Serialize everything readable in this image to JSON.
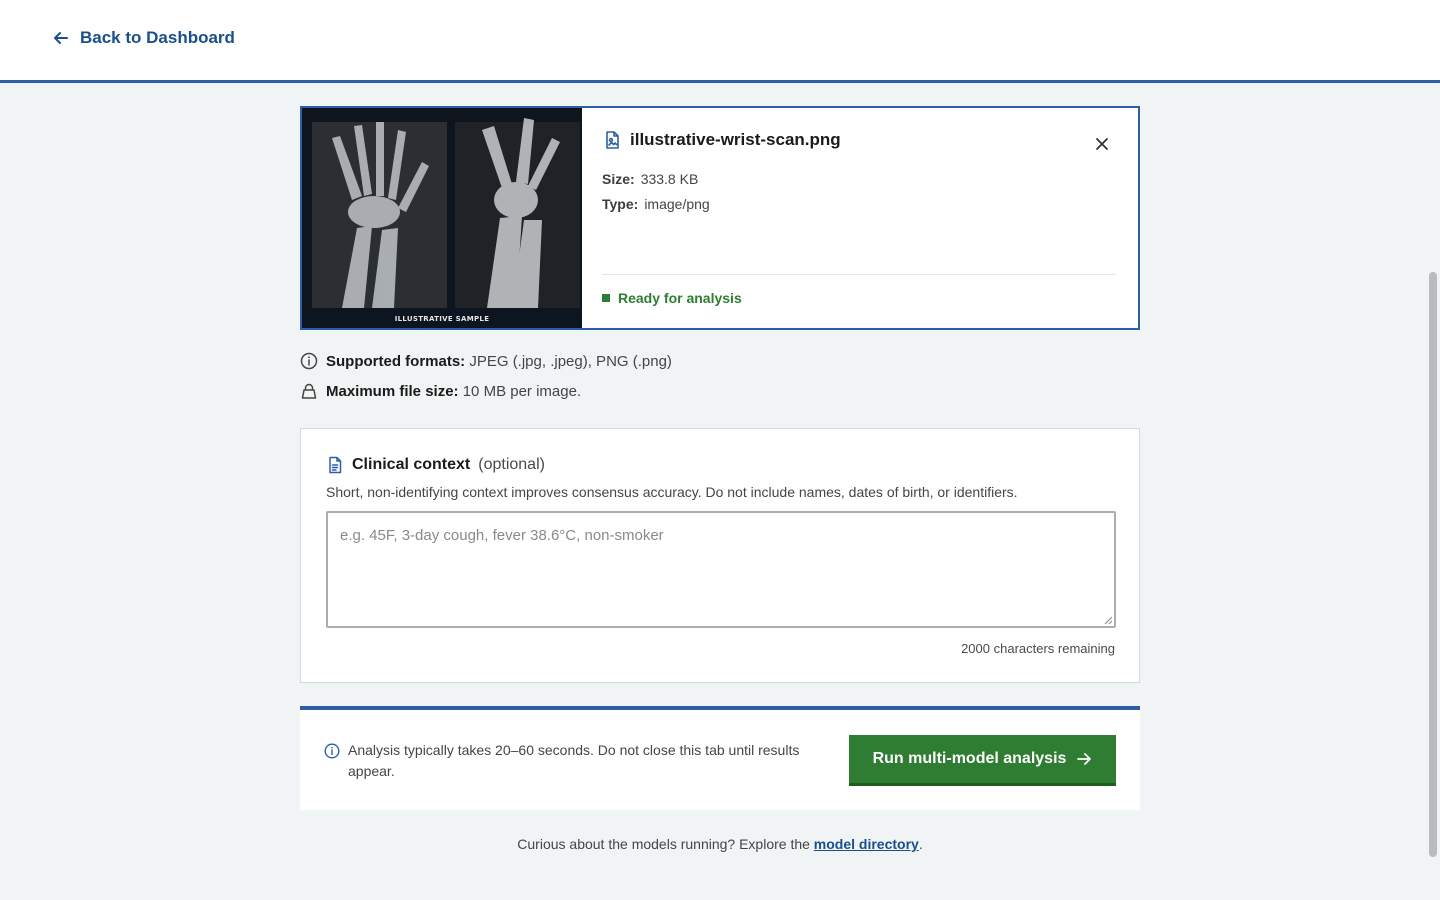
{
  "nav": {
    "back_label": "Back to Dashboard"
  },
  "file": {
    "name": "illustrative-wrist-scan.png",
    "size_key": "Size:",
    "size_value": "333.8 KB",
    "type_key": "Type:",
    "type_value": "image/png",
    "status": "Ready for analysis",
    "thumbnail_caption": "ILLUSTRATIVE SAMPLE"
  },
  "notes": {
    "formats_label": "Supported formats:",
    "formats_value": "JPEG (.jpg, .jpeg), PNG (.png)",
    "maxsize_label": "Maximum file size:",
    "maxsize_value": "10 MB per image."
  },
  "context": {
    "title": "Clinical context",
    "optional": "(optional)",
    "help": "Short, non-identifying context improves consensus accuracy. Do not include names, dates of birth, or identifiers.",
    "placeholder": "e.g. 45F, 3-day cough, fever 38.6°C, non-smoker",
    "value": "",
    "chars_remaining": "2000 characters remaining"
  },
  "run": {
    "note": "Analysis typically takes 20–60 seconds. Do not close this tab until results appear.",
    "button_label": "Run multi-model analysis"
  },
  "footer": {
    "text_before": "Curious about the models running? Explore the ",
    "link_label": "model directory",
    "text_after": "."
  },
  "colors": {
    "accent_blue": "#2e5ea8",
    "link_blue": "#1a4f8c",
    "success_green": "#2e7d32",
    "page_bg": "#f0f4f5"
  },
  "icons": {
    "back": "arrow-left-icon",
    "file": "image-file-icon",
    "close": "close-icon",
    "info": "info-circle-icon",
    "lock": "lock-icon",
    "document": "document-icon",
    "arrow": "arrow-right-icon"
  }
}
